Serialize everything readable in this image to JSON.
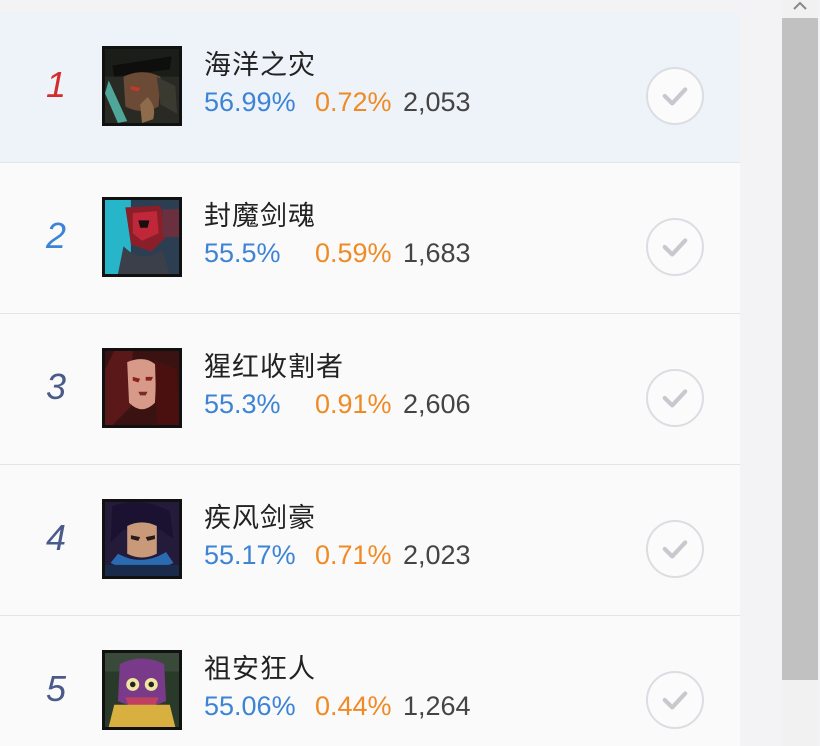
{
  "colors": {
    "winrate": "#3d84d6",
    "pickrate": "#f08a24",
    "games": "#444444",
    "rank_first": "#d42b2b",
    "rank_second": "#3d84d6",
    "rank_default": "#4a5a8a",
    "selected_row": "#eef3fa"
  },
  "heroes": [
    {
      "rank": "1",
      "name": "海洋之灾",
      "winrate": "56.99%",
      "pickrate": "0.72%",
      "games": "2,053",
      "avatar_icon": "gangplank-portrait",
      "selected": true
    },
    {
      "rank": "2",
      "name": "封魔剑魂",
      "winrate": "55.5%",
      "pickrate": "0.59%",
      "games": "1,683",
      "avatar_icon": "yone-portrait",
      "selected": false
    },
    {
      "rank": "3",
      "name": "猩红收割者",
      "winrate": "55.3%",
      "pickrate": "0.91%",
      "games": "2,606",
      "avatar_icon": "vladimir-portrait",
      "selected": false
    },
    {
      "rank": "4",
      "name": "疾风剑豪",
      "winrate": "55.17%",
      "pickrate": "0.71%",
      "games": "2,023",
      "avatar_icon": "yasuo-portrait",
      "selected": false
    },
    {
      "rank": "5",
      "name": "祖安狂人",
      "winrate": "55.06%",
      "pickrate": "0.44%",
      "games": "1,264",
      "avatar_icon": "singed-portrait",
      "selected": false
    }
  ],
  "check_icon": "checkmark-icon"
}
